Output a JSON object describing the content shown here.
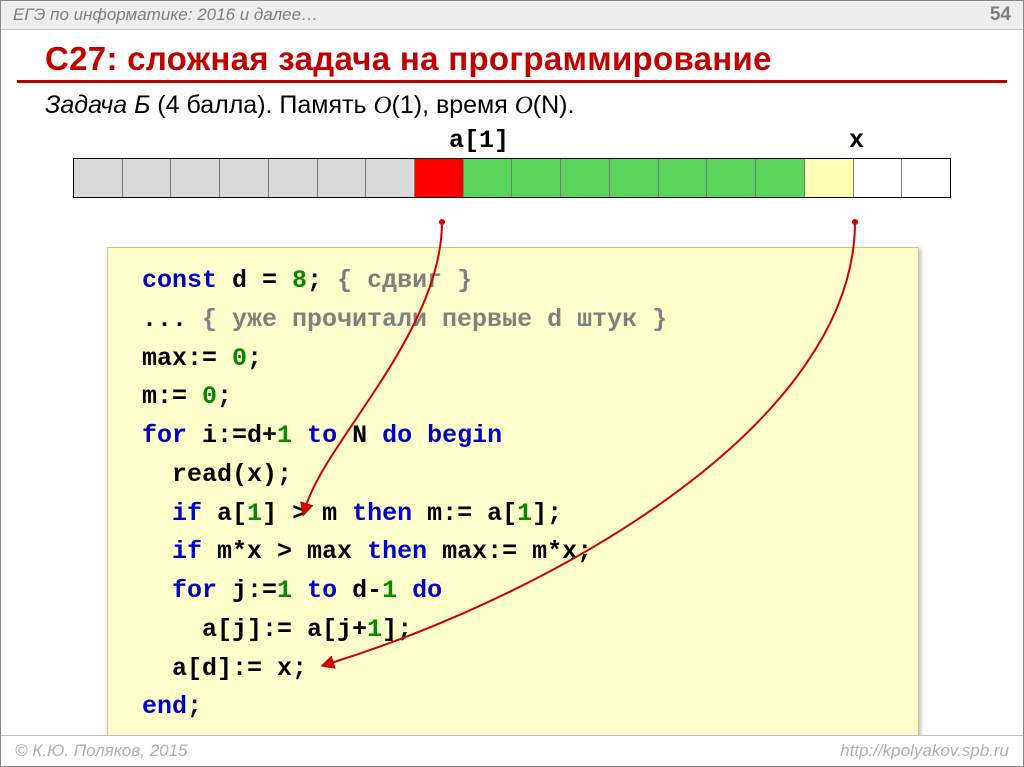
{
  "header": {
    "breadcrumb": "ЕГЭ по информатике: 2016 и далее…",
    "page_number": "54"
  },
  "title": "C27: сложная задача на программирование",
  "subtitle": {
    "prefix": "Задача Б",
    "points": " (4 балла). Память ",
    "o1": "O",
    "o1arg": "(1)",
    "sep": ",  время ",
    "on": "O",
    "onarg": "(N)",
    "tail": "."
  },
  "labels": {
    "a1": "a[1]",
    "x": "x"
  },
  "array_cells": [
    "grey",
    "grey",
    "grey",
    "grey",
    "grey",
    "grey",
    "grey",
    "red",
    "green",
    "green",
    "green",
    "green",
    "green",
    "green",
    "green",
    "yellow",
    "white",
    "white"
  ],
  "code": {
    "l1a": "const",
    "l1b": " d = ",
    "l1c": "8",
    "l1d": "; ",
    "l1e": "{ сдвиг }",
    "l2a": "... ",
    "l2b": "{ уже прочитали первые d штук }",
    "l3": "max:= ",
    "l3n": "0",
    "l3t": ";",
    "l4": "m:= ",
    "l4n": "0",
    "l4t": ";",
    "l5a": "for",
    "l5b": " i:=d+",
    "l5c": "1",
    "l5d": " ",
    "l5e": "to",
    "l5f": " N ",
    "l5g": "do begin",
    "l6": "  read(x);",
    "l7a": "  ",
    "l7b": "if",
    "l7c": " a[",
    "l7d": "1",
    "l7e": "] > m ",
    "l7f": "then",
    "l7g": " m:= a[",
    "l7h": "1",
    "l7i": "];",
    "l8a": "  ",
    "l8b": "if",
    "l8c": " m*x > max ",
    "l8d": "then",
    "l8e": " max:= m*x;",
    "l9a": "  ",
    "l9b": "for",
    "l9c": " j:=",
    "l9d": "1",
    "l9e": " ",
    "l9f": "to",
    "l9g": " d-",
    "l9h": "1",
    "l9i": " ",
    "l9j": "do",
    "l10a": "    a[j]:= a[j+",
    "l10b": "1",
    "l10c": "];",
    "l11a": "  a[d]:= x;",
    "l12a": "end",
    "l12b": ";"
  },
  "footer": {
    "copyright": "© К.Ю. Поляков, 2015",
    "url": "http://kpolyakov.spb.ru"
  }
}
